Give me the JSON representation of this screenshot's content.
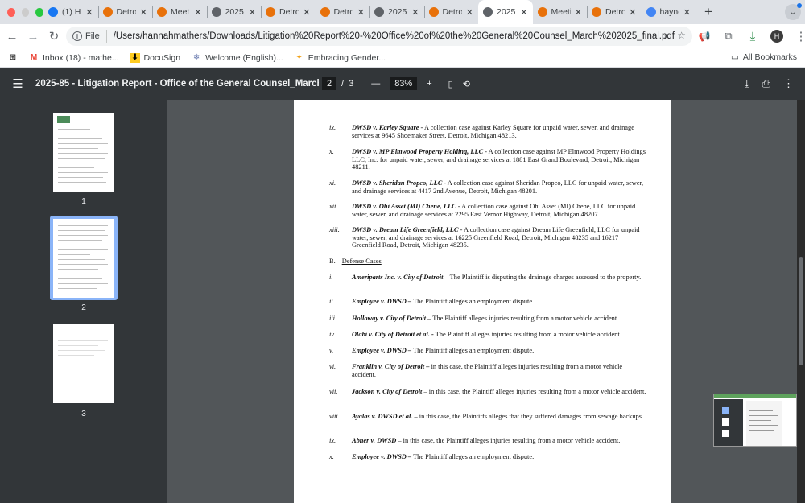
{
  "browser": {
    "tabs": [
      {
        "title": "(1) Ho",
        "favicon": "butterfly-icon",
        "color": "#1877f2"
      },
      {
        "title": "Detro",
        "favicon": "grammarly-icon",
        "color": "#e8710a"
      },
      {
        "title": "Meeti",
        "favicon": "grammarly-icon",
        "color": "#e8710a"
      },
      {
        "title": "2025",
        "favicon": "globe-icon",
        "color": "#5f6368"
      },
      {
        "title": "Detro",
        "favicon": "grammarly-icon",
        "color": "#e8710a"
      },
      {
        "title": "Detro",
        "favicon": "grammarly-icon",
        "color": "#e8710a"
      },
      {
        "title": "2025",
        "favicon": "globe-icon",
        "color": "#5f6368"
      },
      {
        "title": "Detro",
        "favicon": "grammarly-icon",
        "color": "#e8710a"
      },
      {
        "title": "2025",
        "favicon": "globe-icon",
        "color": "#5f6368",
        "active": true
      },
      {
        "title": "Meeti",
        "favicon": "grammarly-icon",
        "color": "#e8710a"
      },
      {
        "title": "Detro",
        "favicon": "grammarly-icon",
        "color": "#e8710a"
      },
      {
        "title": "hayne",
        "favicon": "google-icon",
        "color": "#4285f4"
      }
    ],
    "file_label": "File",
    "url": "/Users/hannahmathers/Downloads/Litigation%20Report%20-%20Office%20of%20the%20General%20Counsel_March%202025_final.pdf",
    "avatar_letter": "H",
    "bookmarks": [
      {
        "label": "Inbox (18) - mathe...",
        "icon": "gmail-icon"
      },
      {
        "label": "DocuSign",
        "icon": "docusign-icon"
      },
      {
        "label": "Welcome (English)...",
        "icon": "snowflake-icon"
      },
      {
        "label": "Embracing Gender...",
        "icon": "sparkle-icon"
      }
    ],
    "all_bookmarks": "All Bookmarks"
  },
  "pdf": {
    "title": "2025-85 - Litigation Report - Office of the General Counsel_March 2025...",
    "current_page": "2",
    "separator": "/",
    "total_pages": "3",
    "zoom": "83%",
    "thumbnails": [
      "1",
      "2",
      "3"
    ]
  },
  "document": {
    "collection_items": [
      {
        "num": "ix.",
        "case": "DWSD v. Karley Square",
        "text": " - A collection case against Karley Square for unpaid water, sewer, and drainage services at 9645 Shoemaker Street, Detroit, Michigan 48213."
      },
      {
        "num": "x.",
        "case": "DWSD v. MP Elmwood Property Holding, LLC",
        "text": " - A collection case against MP Elmwood Property Holdings LLC, Inc. for unpaid water, sewer, and drainage services at 1881 East Grand Boulevard, Detroit, Michigan 48211."
      },
      {
        "num": "xi.",
        "case": "DWSD v. Sheridan Propco, LLC",
        "text": " - A collection case against Sheridan Propco, LLC for unpaid water, sewer, and drainage services at 4417 2nd Avenue, Detroit, Michigan 48201."
      },
      {
        "num": "xii.",
        "case": "DWSD v. Ohi Asset (MI) Chene, LLC",
        "text": " - A collection case against Ohi Asset (MI) Chene, LLC for unpaid water, sewer, and drainage services at 2295 East Vernor Highway, Detroit, Michigan 48207."
      },
      {
        "num": "xiii.",
        "case": "DWSD v. Dream Life Greenfield, LLC",
        "text": " - A collection case against Dream Life Greenfield, LLC for unpaid water, sewer, and drainage services at 16225 Greenfield Road, Detroit, Michigan 48235 and 16217 Greenfield Road, Detroit, Michigan 48235."
      }
    ],
    "section_letter": "B.",
    "section_title": "Defense Cases",
    "defense_items": [
      {
        "num": "i.",
        "case": "Ameriparts Inc. v. City of Detroit",
        "text": " – The Plaintiff is disputing the drainage charges assessed to the property."
      },
      {
        "num": "ii.",
        "case": "Employee v. DWSD –",
        "text": " The Plaintiff alleges an employment dispute."
      },
      {
        "num": "iii.",
        "case": "Holloway v. City of Detroit",
        "text": " – The Plaintiff alleges injuries resulting from a motor vehicle accident."
      },
      {
        "num": "iv.",
        "case": "Olabi v. City of Detroit et al. -",
        "text": " The Plaintiff alleges injuries resulting from a motor vehicle accident."
      },
      {
        "num": "v.",
        "case": "Employee v. DWSD –",
        "text": " The Plaintiff alleges an employment dispute."
      },
      {
        "num": "vi.",
        "case": "Franklin v. City of Detroit –",
        "text": " in this case, the Plaintiff alleges injuries resulting from a motor vehicle accident."
      },
      {
        "num": "vii.",
        "case": "Jackson v. City of Detroit",
        "text": " – in this case, the Plaintiff alleges injuries resulting from a motor vehicle accident."
      },
      {
        "num": "viii.",
        "case": "Ayalas v. DWSD et al.",
        "text": " – in this case, the Plaintiffs alleges that they suffered damages from sewage backups."
      },
      {
        "num": "ix.",
        "case": "Abner v. DWSD",
        "text": " – in this case, the Plaintiff alleges injuries resulting from a motor vehicle accident."
      },
      {
        "num": "x.",
        "case": "Employee v. DWSD –",
        "text": " The Plaintiff alleges an employment dispute."
      }
    ]
  }
}
